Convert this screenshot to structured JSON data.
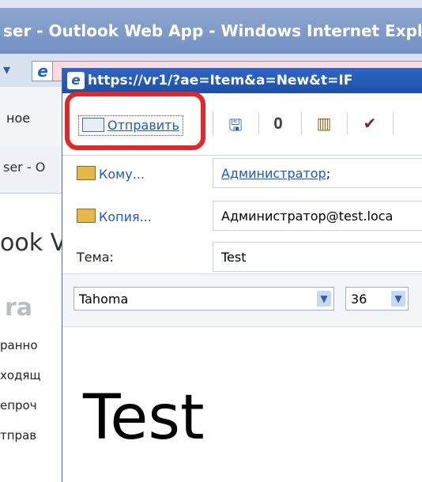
{
  "background_window": {
    "title": "ser - Outlook Web App - Windows Internet Explo",
    "nav_label": "ное",
    "tab_label": "ser - O",
    "heading_fragment": "ook V",
    "section_fragment": "ra",
    "folders": [
      "ранно",
      "ходящ",
      "епроч",
      "тправ"
    ]
  },
  "popup": {
    "title": "https://vr1/?ae=Item&a=New&t=IF",
    "toolbar": {
      "send_label": "Отправить",
      "icons": [
        "save-icon",
        "attach-icon",
        "address-book-icon",
        "check-names-icon"
      ]
    },
    "fields": {
      "to_label": "Кому...",
      "to_value": "Администратор",
      "to_suffix": ";",
      "cc_label": "Копия...",
      "cc_value": "Администратор@test.loca",
      "subject_label": "Тема:",
      "subject_value": "Test"
    },
    "format": {
      "font_name": "Tahoma",
      "font_size": "36"
    },
    "body_text": "Test"
  },
  "colors": {
    "highlight": "#e2262a",
    "link": "#1a58c7",
    "titlebar": "#2f67c7"
  }
}
